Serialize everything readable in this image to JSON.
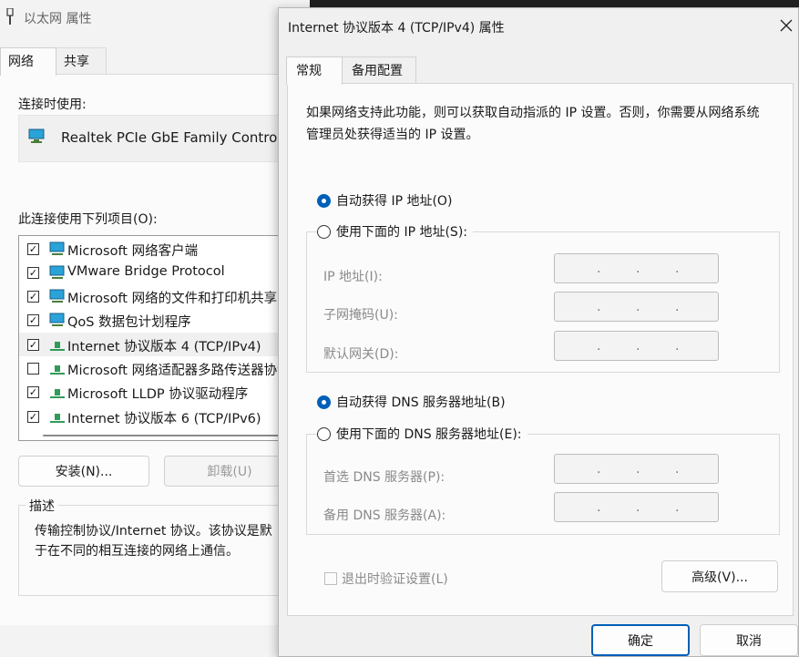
{
  "back_window": {
    "title": "以太网 属性",
    "tabs": [
      "网络",
      "共享"
    ],
    "connect_using_label": "连接时使用:",
    "adapter_name": "Realtek PCIe GbE Family Controll",
    "items_label": "此连接使用下列项目(O):",
    "items": [
      {
        "label": "Microsoft 网络客户端",
        "checked": true,
        "icon": "network-computer-icon"
      },
      {
        "label": "VMware Bridge Protocol",
        "checked": true,
        "icon": "network-computer-icon"
      },
      {
        "label": "Microsoft 网络的文件和打印机共享",
        "checked": true,
        "icon": "network-computer-icon"
      },
      {
        "label": "QoS 数据包计划程序",
        "checked": true,
        "icon": "network-computer-icon"
      },
      {
        "label": "Internet 协议版本 4 (TCP/IPv4)",
        "checked": true,
        "icon": "protocol-icon"
      },
      {
        "label": "Microsoft 网络适配器多路传送器协议",
        "checked": false,
        "icon": "protocol-icon"
      },
      {
        "label": "Microsoft LLDP 协议驱动程序",
        "checked": true,
        "icon": "protocol-icon"
      },
      {
        "label": "Internet 协议版本 6 (TCP/IPv6)",
        "checked": true,
        "icon": "protocol-icon"
      }
    ],
    "install_button": "安装(N)...",
    "uninstall_button": "卸载(U)",
    "description_title": "描述",
    "description_text": "传输控制协议/Internet 协议。该协议是默认的广域网络协议，用于在不同的相互连接的网络上通信。",
    "description_line1": "传输控制协议/Internet 协议。该协议是默",
    "description_line2": "于在不同的相互连接的网络上通信。"
  },
  "dialog": {
    "title": "Internet 协议版本 4 (TCP/IPv4) 属性",
    "tabs": [
      "常规",
      "备用配置"
    ],
    "intro_text": "如果网络支持此功能，则可以获取自动指派的 IP 设置。否则，你需要从网络系统管理员处获得适当的 IP 设置。",
    "ip_auto_label": "自动获得 IP 地址(O)",
    "ip_manual_label": "使用下面的 IP 地址(S):",
    "ip_fields": {
      "ip_address_label": "IP 地址(I):",
      "subnet_mask_label": "子网掩码(U):",
      "gateway_label": "默认网关(D):"
    },
    "dns_auto_label": "自动获得 DNS 服务器地址(B)",
    "dns_manual_label": "使用下面的 DNS 服务器地址(E):",
    "dns_fields": {
      "preferred_label": "首选 DNS 服务器(P):",
      "alternate_label": "备用 DNS 服务器(A):"
    },
    "ip_placeholder_dot": ".",
    "validate_on_exit_label": "退出时验证设置(L)",
    "advanced_button": "高级(V)...",
    "ok_button": "确定",
    "cancel_button": "取消",
    "ip_mode": "auto",
    "dns_mode": "auto",
    "accent_color": "#005fb8"
  }
}
